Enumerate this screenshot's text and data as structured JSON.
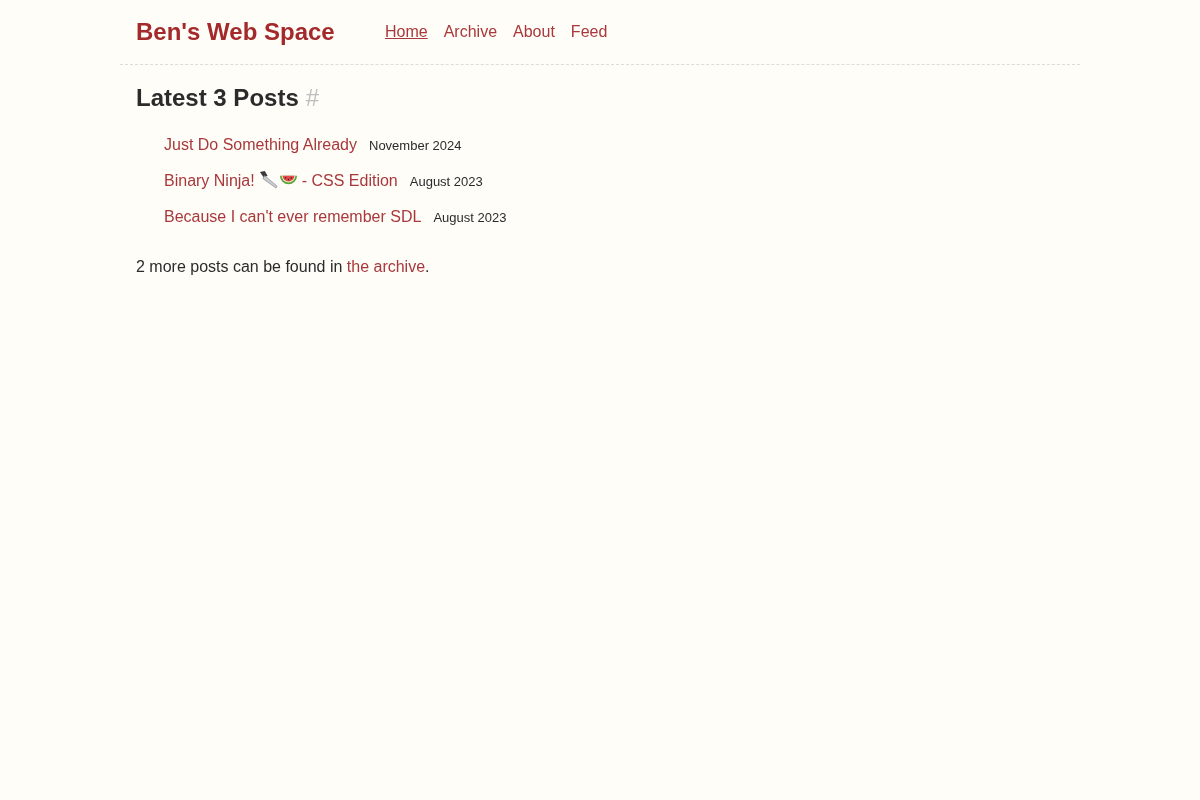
{
  "header": {
    "site_title": "Ben's Web Space",
    "nav": [
      {
        "label": "Home",
        "selected": true
      },
      {
        "label": "Archive",
        "selected": false
      },
      {
        "label": "About",
        "selected": false
      },
      {
        "label": "Feed",
        "selected": false
      }
    ]
  },
  "section": {
    "heading": "Latest 3 Posts",
    "anchor": "#"
  },
  "posts": [
    {
      "segments": [
        {
          "kind": "text",
          "text": "Just Do Something Already"
        }
      ],
      "date": "November 2024"
    },
    {
      "segments": [
        {
          "kind": "text",
          "text": "Binary Ninja!"
        },
        {
          "kind": "knife"
        },
        {
          "kind": "watermelon"
        },
        {
          "kind": "text",
          "text": "- CSS Edition"
        }
      ],
      "date": "August 2023"
    },
    {
      "segments": [
        {
          "kind": "text",
          "text": "Because I can't ever remember SDL"
        }
      ],
      "date": "August 2023"
    }
  ],
  "more": {
    "text_before": "2 more posts can be found in",
    "link": "the archive",
    "text_after": "."
  }
}
